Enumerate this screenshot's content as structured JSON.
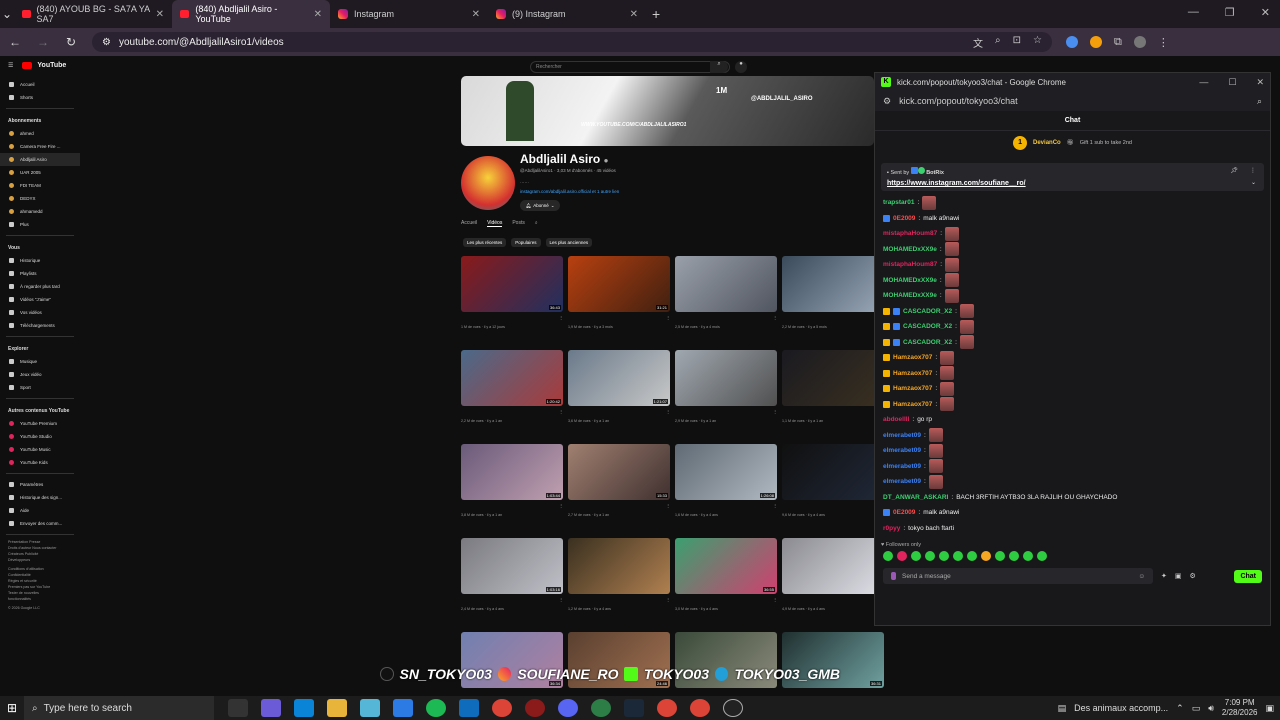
{
  "browser": {
    "tabs": [
      {
        "label": "(840) AYOUB BG - SA7A YA SA7",
        "favicon": "youtube-icon"
      },
      {
        "label": "(840) Abdljalil Asiro - YouTube",
        "favicon": "youtube-icon"
      },
      {
        "label": "Instagram",
        "favicon": "instagram-icon"
      },
      {
        "label": "(9) Instagram",
        "favicon": "instagram-icon"
      }
    ],
    "url": "youtube.com/@AbdljalilAsiro1/videos"
  },
  "youtube": {
    "logo": "YouTube",
    "search_placeholder": "Rechercher",
    "sidebar": {
      "main": [
        "Accueil",
        "Shorts"
      ],
      "subs_title": "Abonnements",
      "subs": [
        "ahmed",
        "Camera Free Fire ...",
        "Abdljalil Asiro",
        "UAR 2005",
        "FDI TEAM",
        "DEDYX",
        "ahmamedd",
        "Plus"
      ],
      "vous_title": "Vous",
      "vous": [
        "Historique",
        "Playlists",
        "À regarder plus tard",
        "Vidéos \"J'aime\"",
        "Vos vidéos",
        "Téléchargements"
      ],
      "explore_title": "Explorer",
      "explore": [
        "Musique",
        "Jeux vidéo",
        "Sport"
      ],
      "more_title": "Autres contenus YouTube",
      "more": [
        "YouTube Premium",
        "YouTube Studio",
        "YouTube Music",
        "YouTube Kids"
      ],
      "settings": [
        "Paramètres",
        "Historique des sign...",
        "Aide",
        "Envoyer des comm..."
      ],
      "footer": [
        "Présentation  Presse",
        "Droits d'auteur  Nous contacter",
        "Créateurs  Publicité",
        "Développeurs",
        "Conditions d'utilisation",
        "Confidentialité",
        "Règles et sécurité",
        "Premiers pas sur YouTube",
        "Tester de nouvelles",
        "fonctionnalités",
        "© 2026 Google LLC"
      ]
    },
    "channel": {
      "name": "Abdljalil Asiro",
      "meta": "@AbdljalilAsiro1 · 3,03 M d'abonnés · 45 vidéos",
      "link": "instagram.com/abdljalil.asiro.official et 1 autre lien",
      "subscribe": "Abonné",
      "banner_url": "WWW.YOUTUBE.COM/C/ABDLJALILASIRO1",
      "banner_handle": "@ABDLJALIL_ASIRO",
      "banner_badge": "1M",
      "tabs": [
        "Accueil",
        "Vidéos",
        "Posts"
      ],
      "chips": [
        "Les plus récentes",
        "Populaires",
        "Les plus anciennes"
      ]
    },
    "videos": [
      {
        "dur": "36:43",
        "meta": "1 M de vues · il y a 12 jours"
      },
      {
        "dur": "31:21",
        "meta": "1,9 M de vues · il y a 3 mois"
      },
      {
        "dur": "",
        "meta": "2,5 M de vues · il y a 4 mois"
      },
      {
        "dur": "",
        "meta": "2,2 M de vues · il y a 5 mois"
      },
      {
        "dur": "1:20:42",
        "meta": "2,2 M de vues · il y a 1 an"
      },
      {
        "dur": "1:21:07",
        "meta": "3,6 M de vues · il y a 1 an"
      },
      {
        "dur": "",
        "meta": "2,9 M de vues · il y a 1 an"
      },
      {
        "dur": "",
        "meta": "1,1 M de vues · il y a 1 an"
      },
      {
        "dur": "1:03:44",
        "meta": "3,8 M de vues · il y a 1 an"
      },
      {
        "dur": "15:33",
        "meta": "2,7 M de vues · il y a 1 an"
      },
      {
        "dur": "1:26:08",
        "meta": "1,6 M de vues · il y a 4 ans"
      },
      {
        "dur": "",
        "meta": "9,6 M de vues · il y a 4 ans"
      },
      {
        "dur": "1:03:16",
        "meta": "2,4 M de vues · il y a 4 ans"
      },
      {
        "dur": "",
        "meta": "1,2 M de vues · il y a 4 ans"
      },
      {
        "dur": "36:55",
        "meta": "3,0 M de vues · il y a 4 ans"
      },
      {
        "dur": "",
        "meta": "4,9 M de vues · il y a 4 ans"
      },
      {
        "dur": "36:34",
        "meta": ""
      },
      {
        "dur": "24:46",
        "meta": ""
      },
      {
        "dur": "",
        "meta": ""
      },
      {
        "dur": "36:31",
        "meta": ""
      }
    ]
  },
  "overlay": {
    "items": [
      "SN_TOKYO03",
      "SOUFIANE_RO",
      "TOKYO03",
      "TOKYO03_GMB"
    ]
  },
  "kick": {
    "window_title": "kick.com/popout/tokyoo3/chat - Google Chrome",
    "url": "kick.com/popout/tokyoo3/chat",
    "header": "Chat",
    "gift_user": "DevianCo",
    "gift_count": "1",
    "gift_text": "Gift 1 sub to take 2nd",
    "pinned_by": "Sent by",
    "pinned_user": "BotRix",
    "pinned_link": "https://www.instagram.com/soufiane__ro/",
    "messages": [
      {
        "user": "trapstar01",
        "color": "#3cd070",
        "text": ""
      },
      {
        "user": "0E2009",
        "color": "#ff4b4b",
        "text": "malk a9nawi"
      },
      {
        "user": "mistaphaHoum87",
        "color": "#e0245e",
        "text": ""
      },
      {
        "user": "MOHAMEDxXX9e",
        "color": "#3cd070",
        "text": ""
      },
      {
        "user": "mistaphaHoum87",
        "color": "#e0245e",
        "text": ""
      },
      {
        "user": "MOHAMEDxXX9e",
        "color": "#3cd070",
        "text": ""
      },
      {
        "user": "MOHAMEDxXX9e",
        "color": "#3cd070",
        "text": ""
      },
      {
        "user": "CASCADOR_X2",
        "color": "#3cd070",
        "text": ""
      },
      {
        "user": "CASCADOR_X2",
        "color": "#3cd070",
        "text": ""
      },
      {
        "user": "CASCADOR_X2",
        "color": "#3cd070",
        "text": ""
      },
      {
        "user": "Hamzaox707",
        "color": "#f5a623",
        "text": ""
      },
      {
        "user": "Hamzaox707",
        "color": "#f5a623",
        "text": ""
      },
      {
        "user": "Hamzaox707",
        "color": "#f5a623",
        "text": ""
      },
      {
        "user": "Hamzaox707",
        "color": "#f5a623",
        "text": ""
      },
      {
        "user": "abdoellll",
        "color": "#e0245e",
        "text": "go rp"
      },
      {
        "user": "elmerabet09",
        "color": "#3b82f6",
        "text": ""
      },
      {
        "user": "elmerabet09",
        "color": "#3b82f6",
        "text": ""
      },
      {
        "user": "elmerabet09",
        "color": "#3b82f6",
        "text": ""
      },
      {
        "user": "elmerabet09",
        "color": "#3b82f6",
        "text": ""
      },
      {
        "user": "DT_ANWAR_ASKARI",
        "color": "#3cd070",
        "text": "BACH 3RFTIH AYTB3O 3LA RAJLIH OU GHAYCHADO"
      },
      {
        "user": "0E2009",
        "color": "#ff4b4b",
        "text": "malk a9nawi"
      },
      {
        "user": "r0pyy",
        "color": "#e0245e",
        "text": "tokyo bach ftarti"
      }
    ],
    "followers_only": "Followers only",
    "send_placeholder": "Send a message",
    "chat_button": "Chat"
  },
  "taskbar": {
    "search": "Type here to search",
    "news": "Des animaux accomp...",
    "time": "7:09 PM",
    "date": "2/28/2026"
  }
}
